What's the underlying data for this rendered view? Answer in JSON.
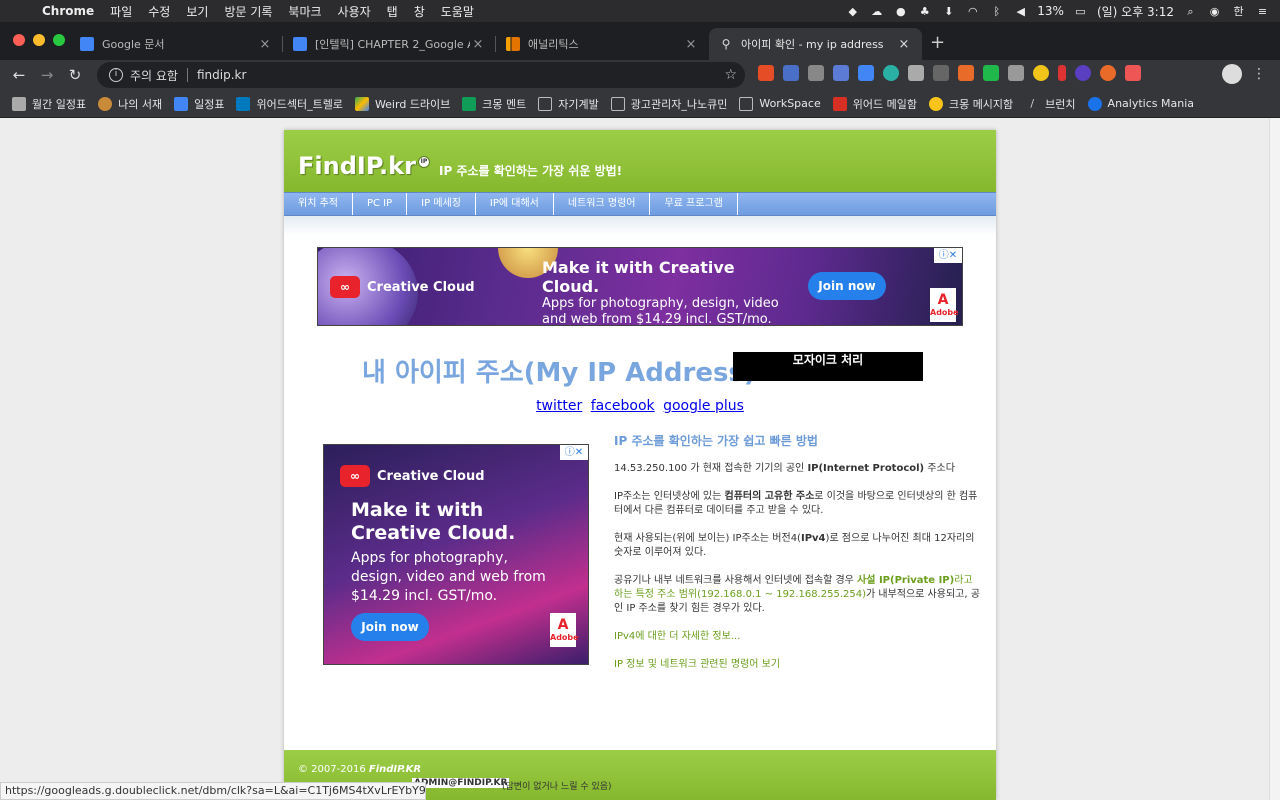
{
  "menubar": {
    "app": "Chrome",
    "items": [
      "파일",
      "수정",
      "보기",
      "방문 기록",
      "북마크",
      "사용자",
      "탭",
      "창",
      "도움말"
    ],
    "battery": "13%",
    "clock": "(일) 오후 3:12",
    "input_method": "한"
  },
  "tabs": [
    {
      "title": "Google 문서",
      "favicon_color": "#4285f4"
    },
    {
      "title": "[인텔릭] CHAPTER 2_Google Ana",
      "favicon_color": "#4285f4"
    },
    {
      "title": "애널리틱스",
      "favicon_color": "#f4a100"
    },
    {
      "title": "아이피 확인 - my ip address",
      "favicon_color": "#cccccc"
    }
  ],
  "omnibox": {
    "security": "주의 요함",
    "url": "findip.kr"
  },
  "bookmarks": [
    {
      "label": "월간 일정표",
      "color": "#aaaaaa"
    },
    {
      "label": "나의 서재",
      "color": "#c98a3a"
    },
    {
      "label": "일정표",
      "color": "#4285f4"
    },
    {
      "label": "위어드섹터_트렐로",
      "color": "#0079bf"
    },
    {
      "label": "Weird 드라이브",
      "color": "#34a853"
    },
    {
      "label": "크몽 멘트",
      "color": "#0f9d58"
    },
    {
      "label": "자기계발",
      "color": "#bbbbbb"
    },
    {
      "label": "광고관리자_나노큐민",
      "color": "#bbbbbb"
    },
    {
      "label": "WorkSpace",
      "color": "#bbbbbb"
    },
    {
      "label": "위어드 메일함",
      "color": "#d93025"
    },
    {
      "label": "크몽 메시지함",
      "color": "#f9c31a"
    },
    {
      "label": "브런치",
      "color": "#333333"
    },
    {
      "label": "Analytics Mania",
      "color": "#1a73e8"
    }
  ],
  "site": {
    "logo": "FindIP.kr",
    "logo_badge": "IP",
    "tagline": "IP 주소를 확인하는 가장 쉬운 방법!",
    "nav": [
      "위치 추적",
      "PC IP",
      "IP 메세징",
      "IP에 대해서",
      "네트워크 명령어",
      "무료 프로그램"
    ]
  },
  "ad_banner": {
    "brand": "Creative Cloud",
    "headline": "Make it with Creative Cloud.",
    "body": "Apps for photography, design, video and web from $14.29 incl. GST/mo.",
    "button": "Join now",
    "adobe": "Adobe"
  },
  "ad_square": {
    "brand": "Creative Cloud",
    "headline": "Make it with Creative Cloud.",
    "body": "Apps for photography, design, video and web from $14.29 incl. GST/mo.",
    "button": "Join now",
    "adobe": "Adobe"
  },
  "ip_heading": "내 아이피 주소(My IP Address) :",
  "ip_value": "모자이크 처리",
  "social": [
    "twitter",
    "facebook",
    "google plus"
  ],
  "info": {
    "title": "IP 주소를 확인하는 가장 쉽고 빠른 방법",
    "p1_a": "14.53.250.100 가 현재 접속한 기기의 공인 ",
    "p1_b": "IP(Internet Protocol)",
    "p1_c": " 주소다",
    "p2_a": "IP주소는 인터넷상에 있는 ",
    "p2_b": "컴퓨터의 고유한 주소",
    "p2_c": "로 이것을 바탕으로 인터넷상의 한 컴퓨터에서 다른 컴퓨터로 데이터를 주고 받을 수 있다.",
    "p3_a": "현재 사용되는(위에 보이는) IP주소는 버전4(",
    "p3_b": "IPv4",
    "p3_c": ")로 점으로 나누어진 최대 12자리의 숫자로 이루어져 있다.",
    "p4_a": "공유기나 내부 네트워크를 사용해서 인터넷에 접속할 경우 ",
    "p4_b": "사설 IP(Private IP)",
    "p4_c": "라고 하는 특정 주소 범위(192.168.0.1 ~ 192.168.255.254)",
    "p4_d": "가 내부적으로 사용되고, 공인 IP 주소를 찾기 힘든 경우가 있다.",
    "link1": "IPv4에 대한 더 자세한 정보...",
    "link2": "IP 정보 및 네트워크 관련된 명령어 보기"
  },
  "footer": {
    "copy_a": "© 2007-2016 ",
    "copy_b": "FindIP.KR",
    "admin": "ADMIN@FINDIP.KR",
    "admin_note": "(답변이 없거나 느릴 수 있음)"
  },
  "status_url": "https://googleads.g.doubleclick.net/dbm/clk?sa=L&ai=C1Tj6MS4tXvLrEYbY9QWu67..."
}
